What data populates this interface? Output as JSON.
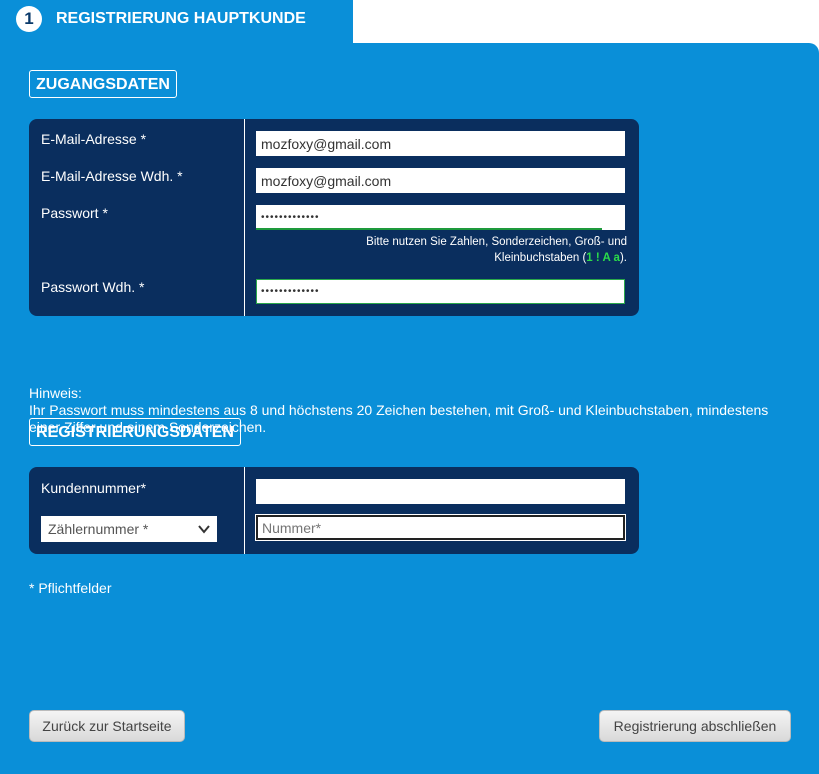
{
  "header": {
    "step_number": "1",
    "title": "REGISTRIERUNG HAUPTKUNDE"
  },
  "access": {
    "section_title": "ZUGANGSDATEN",
    "email_label": "E-Mail-Adresse *",
    "email_value": "mozfoxy@gmail.com",
    "email_repeat_label": "E-Mail-Adresse Wdh. *",
    "email_repeat_value": "mozfoxy@gmail.com",
    "password_label": "Passwort *",
    "password_value": "•••••••••••••",
    "password_hint_line1": "Bitte nutzen Sie Zahlen, Sonderzeichen, Groß- und",
    "password_hint_line2_prefix": "Kleinbuchstaben (",
    "password_hint_symbols": "1 ! A a",
    "password_hint_line2_suffix": ").",
    "password_repeat_label": "Passwort Wdh. *",
    "password_repeat_value": "•••••••••••••",
    "strength_color": "#1e9a3c"
  },
  "note": {
    "line1": "Hinweis:",
    "line2": "Ihr Passwort muss mindestens aus 8 und höchstens 20 Zeichen bestehen, mit Groß- und Kleinbuchstaben, mindestens einer Ziffer und einem Sonderzeichen."
  },
  "registration": {
    "section_title": "REGISTRIERUNGSDATEN",
    "customer_number_label": "Kundennummer*",
    "customer_number_value": "",
    "meter_select_value": "Zählernummer *",
    "number_placeholder": "Nummer*"
  },
  "required_note": "* Pflichtfelder",
  "buttons": {
    "back": "Zurück zur Startseite",
    "finish": "Registrierung abschließen"
  },
  "colors": {
    "panel": "#0a8fd8",
    "box": "#0a2e5e",
    "accent_green": "#2bdc4a"
  }
}
